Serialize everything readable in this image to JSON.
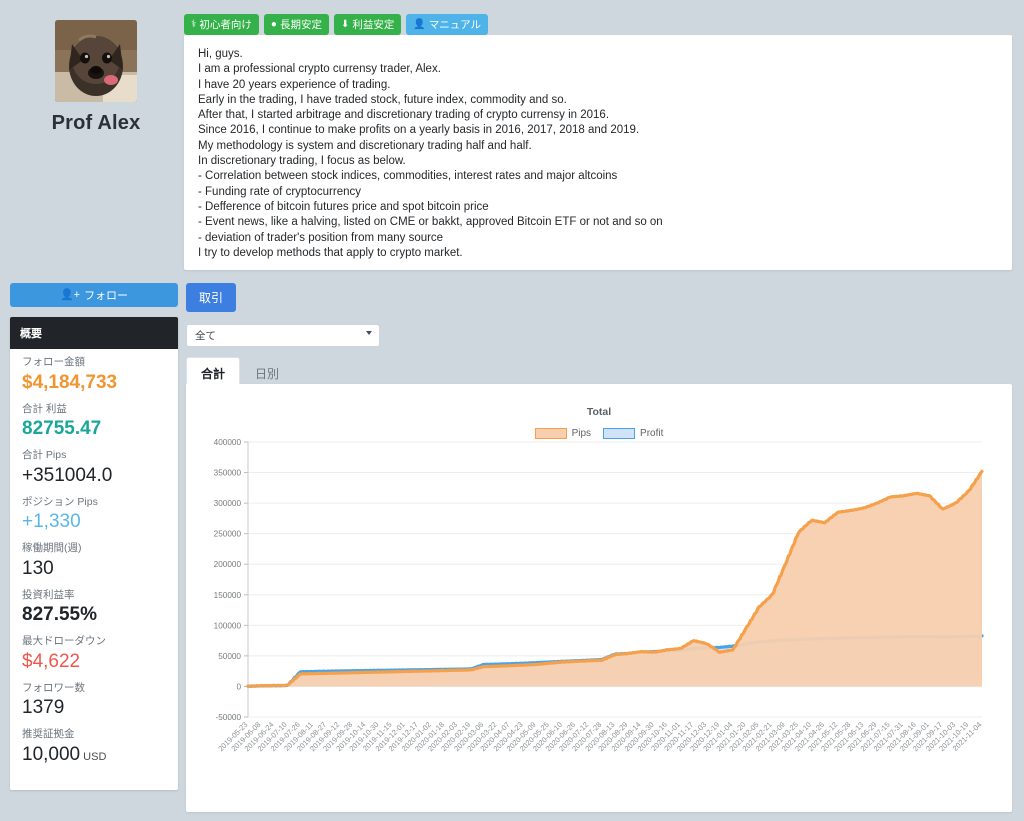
{
  "profile": {
    "name": "Prof Alex",
    "avatar_alt": "dog-photo-avatar",
    "badges": [
      {
        "label": "初心者向け",
        "icon": "beginner-icon",
        "color": "#35b14a"
      },
      {
        "label": "長期安定",
        "icon": "droplet-icon",
        "color": "#35b14a"
      },
      {
        "label": "利益安定",
        "icon": "download-icon",
        "color": "#35b14a"
      },
      {
        "label": "マニュアル",
        "icon": "user-icon",
        "color": "#4db3e8"
      }
    ],
    "bio_lines": [
      "Hi, guys.",
      "I am a professional crypto currensy trader, Alex.",
      "I have 20 years experience of trading.",
      "Early in the trading, I have traded stock, future index, commodity and so.",
      "After that, I started arbitrage and discretionary trading of crypto currensy in 2016.",
      "Since 2016, I continue to make profits on a yearly basis in 2016, 2017, 2018 and 2019.",
      "My methodology is system and discretionary trading half and half.",
      "In discretionary trading, I focus as below.",
      "- Correlation between stock indices, commodities, interest rates and major altcoins",
      "- Funding rate of cryptocurrency",
      "- Defference of bitcoin futures price and spot bitcoin price",
      "- Event news, like a halving, listed on CME or bakkt, approved Bitcoin ETF or not and so on",
      "- deviation of trader's position from many source",
      "I try to develop methods that apply to crypto market."
    ]
  },
  "sidebar": {
    "follow_button": "フォロー",
    "follow_icon": "user-plus-icon",
    "card_title": "概要",
    "stats": [
      {
        "label": "フォロー金額",
        "value": "$4,184,733",
        "color": "#f0952f",
        "bold": true
      },
      {
        "label": "合計 利益",
        "value": "82755.47",
        "color": "#1aa79a",
        "bold": true
      },
      {
        "label": "合計 Pips",
        "value": "+351004.0",
        "color": "#212529",
        "bold": false
      },
      {
        "label": "ポジション Pips",
        "value": "+1,330",
        "color": "#5bb6e8",
        "bold": false
      },
      {
        "label": "稼働期間(週)",
        "value": "130",
        "color": "#212529",
        "bold": false
      },
      {
        "label": "投資利益率",
        "value": "827.55%",
        "color": "#212529",
        "bold": true
      },
      {
        "label": "最大ドローダウン",
        "value": "$4,622",
        "color": "#f0574d",
        "bold": false
      },
      {
        "label": "フォロワー数",
        "value": "1379",
        "color": "#212529",
        "bold": false
      },
      {
        "label": "推奨証拠金",
        "value": "10,000",
        "unit": "USD",
        "color": "#212529",
        "bold": false
      }
    ]
  },
  "main": {
    "trade_button": "取引",
    "filter_select": {
      "value": "全て",
      "options": [
        "全て"
      ]
    },
    "tabs": [
      {
        "label": "合計",
        "active": true
      },
      {
        "label": "日別",
        "active": false
      }
    ]
  },
  "chart_data": {
    "type": "area",
    "title": "Total",
    "xlabel": "",
    "ylabel": "",
    "ylim": [
      -50000,
      400000
    ],
    "yticks": [
      -50000,
      0,
      50000,
      100000,
      150000,
      200000,
      250000,
      300000,
      350000,
      400000
    ],
    "grid": true,
    "legend_position": "top",
    "colors": {
      "pips_line": "#f5a04b",
      "pips_fill": "#f7cfae",
      "profit_line": "#4aa3e8",
      "profit_fill": "#cfe2f7"
    },
    "categories": [
      "2019-05-23",
      "2019-06-08",
      "2019-06-24",
      "2019-07-10",
      "2019-07-26",
      "2019-08-11",
      "2019-08-27",
      "2019-09-12",
      "2019-09-28",
      "2019-10-14",
      "2019-10-30",
      "2019-11-15",
      "2019-12-01",
      "2019-12-17",
      "2020-01-02",
      "2020-01-18",
      "2020-02-03",
      "2020-02-19",
      "2020-03-06",
      "2020-03-22",
      "2020-04-07",
      "2020-04-23",
      "2020-05-09",
      "2020-05-25",
      "2020-06-10",
      "2020-06-26",
      "2020-07-12",
      "2020-07-28",
      "2020-08-13",
      "2020-08-29",
      "2020-09-14",
      "2020-09-30",
      "2020-10-16",
      "2020-11-01",
      "2020-11-17",
      "2020-12-03",
      "2020-12-19",
      "2021-01-04",
      "2021-01-20",
      "2021-02-05",
      "2021-02-21",
      "2021-03-09",
      "2021-03-25",
      "2021-04-10",
      "2021-04-26",
      "2021-05-12",
      "2021-05-28",
      "2021-06-13",
      "2021-06-29",
      "2021-07-15",
      "2021-07-31",
      "2021-08-16",
      "2021-09-01",
      "2021-09-17",
      "2021-10-03",
      "2021-10-19",
      "2021-11-04"
    ],
    "series": [
      {
        "name": "Pips",
        "values": [
          500,
          1200,
          1500,
          1800,
          20500,
          21000,
          21500,
          22000,
          22500,
          23000,
          23500,
          24000,
          24500,
          25000,
          25500,
          26000,
          26500,
          27000,
          32500,
          33000,
          34000,
          35000,
          36000,
          38000,
          40000,
          41000,
          42000,
          43000,
          52000,
          54000,
          57000,
          56000,
          60000,
          62000,
          75000,
          70000,
          56000,
          60000,
          95000,
          130000,
          150000,
          200000,
          252000,
          272000,
          268000,
          285000,
          288000,
          292000,
          300000,
          310000,
          312000,
          316000,
          312000,
          290000,
          300000,
          320000,
          352000
        ]
      },
      {
        "name": "Profit",
        "values": [
          300,
          900,
          1100,
          1400,
          24000,
          24500,
          25000,
          25300,
          25600,
          26000,
          26300,
          26600,
          27000,
          27300,
          27600,
          28000,
          28300,
          28600,
          36000,
          36500,
          37200,
          38000,
          39000,
          40000,
          41000,
          42000,
          43000,
          44000,
          53000,
          54000,
          56000,
          57000,
          58000,
          59000,
          62000,
          63000,
          64000,
          66000,
          70000,
          73000,
          75000,
          76000,
          77000,
          78000,
          78500,
          79000,
          79500,
          80000,
          80500,
          81000,
          81200,
          81500,
          81800,
          81000,
          81500,
          82000,
          82755
        ]
      }
    ]
  }
}
